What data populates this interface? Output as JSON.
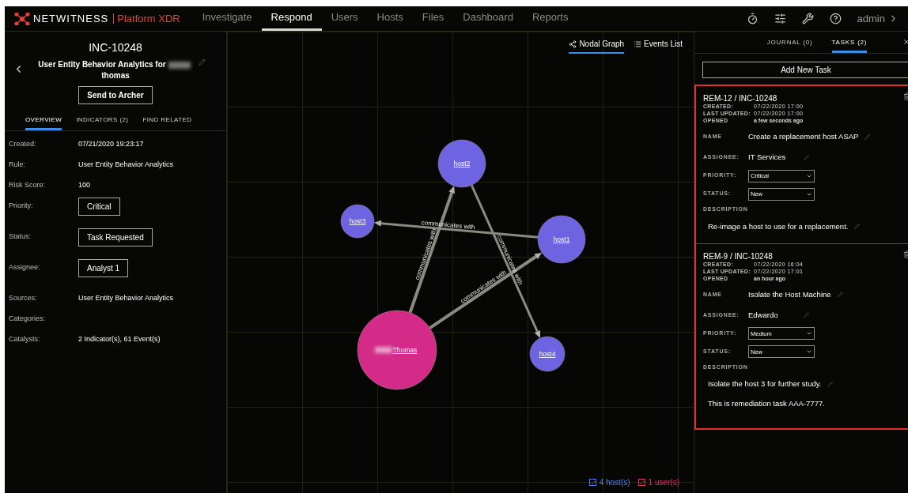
{
  "nav": {
    "logo": "NETWITNESS",
    "product": "Platform XDR",
    "items": [
      {
        "label": "Investigate",
        "selected": false
      },
      {
        "label": "Respond",
        "selected": true
      },
      {
        "label": "Users",
        "selected": false
      },
      {
        "label": "Hosts",
        "selected": false
      },
      {
        "label": "Files",
        "selected": false
      },
      {
        "label": "Dashboard",
        "selected": false
      },
      {
        "label": "Reports",
        "selected": false
      }
    ],
    "user": "admin"
  },
  "incident": {
    "id": "INC-10248",
    "title_start": "User Entity Behavior Analytics for",
    "title_end": "thomas",
    "send_button": "Send to Archer",
    "tabs": [
      {
        "label": "OVERVIEW",
        "selected": true
      },
      {
        "label": "INDICATORS (2)",
        "selected": false
      },
      {
        "label": "FIND RELATED",
        "selected": false
      }
    ],
    "fields": [
      {
        "kind": "text",
        "label": "Created:",
        "value": "07/21/2020 19:23:17"
      },
      {
        "kind": "text",
        "label": "Rule:",
        "value": "User Entity Behavior Analytics"
      },
      {
        "kind": "text",
        "label": "Risk Score:",
        "value": "100"
      },
      {
        "kind": "button",
        "label": "Priority:",
        "value": "Critical"
      },
      {
        "kind": "button",
        "label": "Status:",
        "value": "Task Requested"
      },
      {
        "kind": "button",
        "label": "Assignee:",
        "value": "Analyst 1"
      },
      {
        "kind": "text",
        "label": "Sources:",
        "value": "User Entity Behavior Analytics"
      },
      {
        "kind": "text",
        "label": "Categories:"
      },
      {
        "kind": "text",
        "label": "Catalysts:",
        "value": "2 Indicator(s), 61 Event(s)"
      }
    ]
  },
  "graph": {
    "views": [
      {
        "label": "Nodal Graph",
        "selected": true,
        "kind": "graph"
      },
      {
        "label": "Events List",
        "selected": false,
        "kind": "list"
      }
    ],
    "nodes": [
      {
        "label": "host2",
        "kind": "host"
      },
      {
        "label": "host3",
        "kind": "host"
      },
      {
        "label": "host1",
        "kind": "host"
      },
      {
        "label": "host4",
        "kind": "host"
      },
      {
        "label": "Thomas",
        "kind": "user"
      }
    ],
    "edges": [
      {
        "label": "communicates with"
      },
      {
        "label": "communicates with"
      },
      {
        "label": "communicates with"
      },
      {
        "label": "communicates with"
      }
    ],
    "legend": [
      {
        "label": "4 host(s)",
        "checked": true,
        "color": "#5b7cf0"
      },
      {
        "label": "1 user(s)",
        "checked": true,
        "color": "#e0306c"
      }
    ]
  },
  "panel": {
    "tabs": [
      {
        "label": "JOURNAL (0)",
        "selected": false
      },
      {
        "label": "TASKS (2)",
        "selected": true
      }
    ],
    "add_button": "Add New Task",
    "tasks": [
      {
        "id": "REM-12 / INC-10248",
        "created_label": "CREATED:",
        "created": "07/22/2020 17:00",
        "updated_label": "LAST UPDATED:",
        "updated": "07/22/2020 17:00",
        "opened_label": "OPENED",
        "opened": "a few seconds ago",
        "name_label": "NAME",
        "name": "Create a replacement host ASAP",
        "assignee_label": "ASSIGNEE:",
        "assignee": "IT Services",
        "priority_label": "PRIORITY:",
        "priority": "Critical",
        "status_label": "STATUS:",
        "status": "New",
        "description_label": "DESCRIPTION",
        "description": [
          "Re-image a host to use for a replacement."
        ]
      },
      {
        "id": "REM-9 / INC-10248",
        "created_label": "CREATED:",
        "created": "07/22/2020 16:04",
        "updated_label": "LAST UPDATED:",
        "updated": "07/22/2020 17:01",
        "opened_label": "OPENED",
        "opened": "an hour ago",
        "name_label": "NAME",
        "name": "Isolate the Host Machine",
        "assignee_label": "ASSIGNEE:",
        "assignee": "Edwardo",
        "priority_label": "PRIORITY:",
        "priority": "Medium",
        "status_label": "STATUS:",
        "status": "New",
        "description_label": "DESCRIPTION",
        "description": [
          "Isolate the host 3 for further study.",
          "This is remediation task AAA-7777."
        ]
      }
    ]
  }
}
